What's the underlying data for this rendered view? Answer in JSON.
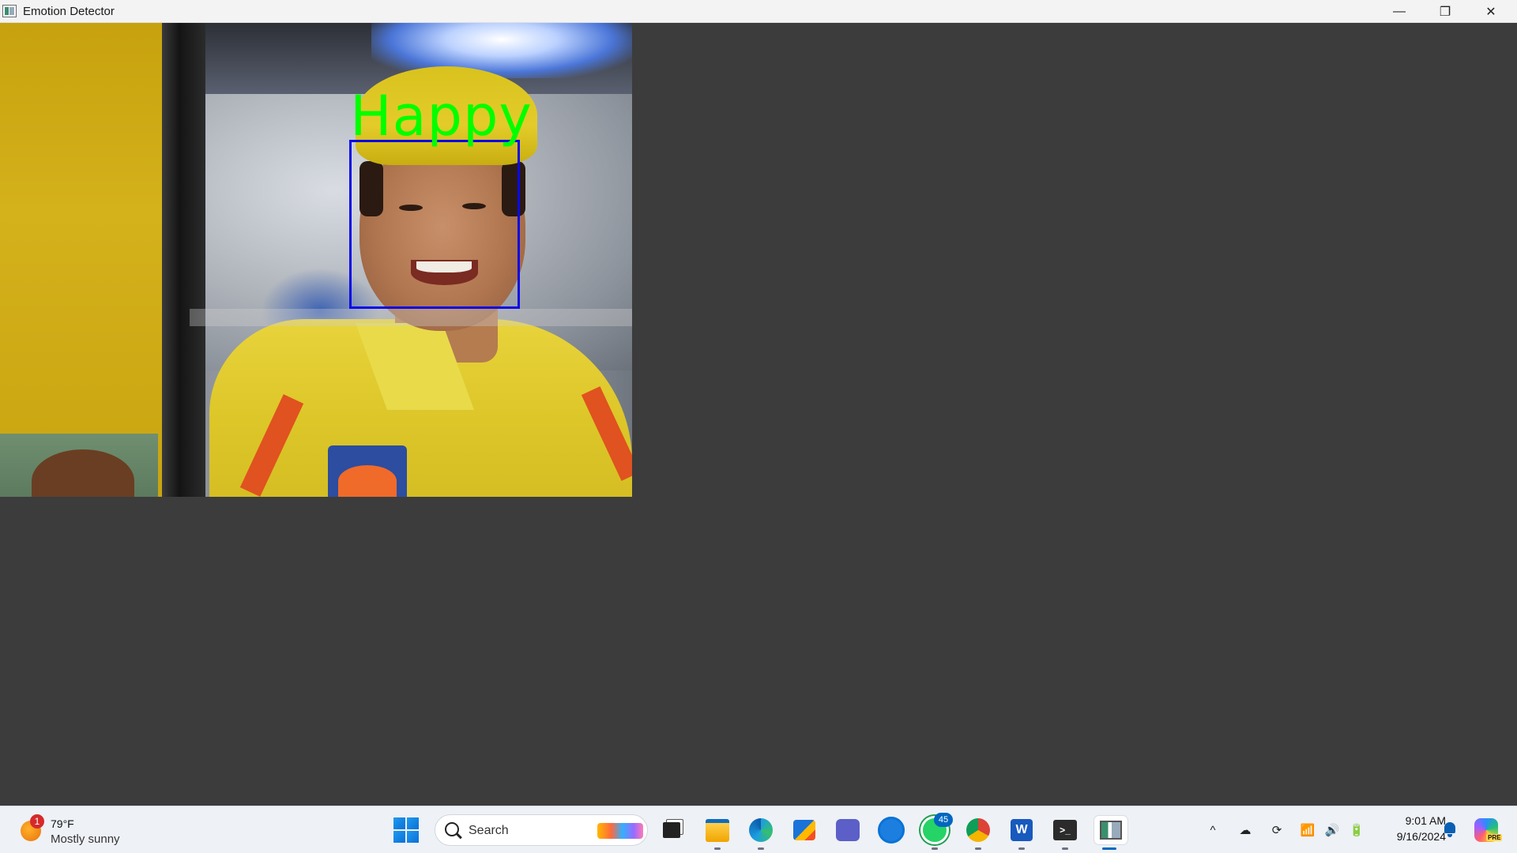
{
  "window": {
    "title": "Emotion Detector",
    "controls": {
      "minimize": "—",
      "maximize": "❐",
      "close": "✕"
    }
  },
  "detection": {
    "emotion_label": "Happy",
    "label_color": "#00ff00",
    "box_color": "#0a0ae6"
  },
  "taskbar": {
    "weather": {
      "badge": "1",
      "temperature": "79°F",
      "condition": "Mostly sunny"
    },
    "search": {
      "label": "Search"
    },
    "apps": [
      {
        "name": "Task View",
        "icon": "task-view-icon"
      },
      {
        "name": "File Explorer",
        "icon": "folder-icon"
      },
      {
        "name": "Microsoft Edge",
        "icon": "edge-icon"
      },
      {
        "name": "Microsoft Store",
        "icon": "store-icon"
      },
      {
        "name": "Microsoft Teams",
        "icon": "teams-icon"
      },
      {
        "name": "Dell",
        "icon": "dell-icon"
      },
      {
        "name": "WhatsApp",
        "icon": "whatsapp-icon",
        "badge": "45"
      },
      {
        "name": "Google Chrome",
        "icon": "chrome-icon"
      },
      {
        "name": "Microsoft Word",
        "icon": "word-icon"
      },
      {
        "name": "Terminal",
        "icon": "terminal-icon"
      },
      {
        "name": "Emotion Detector",
        "icon": "emotion-detector-icon",
        "active": true
      }
    ],
    "tray": {
      "chevron": "^",
      "onedrive": "☁",
      "sync": "⟳",
      "wifi": "📶",
      "volume": "🔊",
      "battery": "🔋"
    },
    "clock": {
      "time": "9:01 AM",
      "date": "9/16/2024"
    },
    "copilot_tag": "PRE"
  },
  "colors": {
    "accent": "#0067c0",
    "client_bg": "#3c3c3c",
    "titlebar_bg": "#f3f3f3",
    "taskbar_bg": "#eef1f6"
  }
}
